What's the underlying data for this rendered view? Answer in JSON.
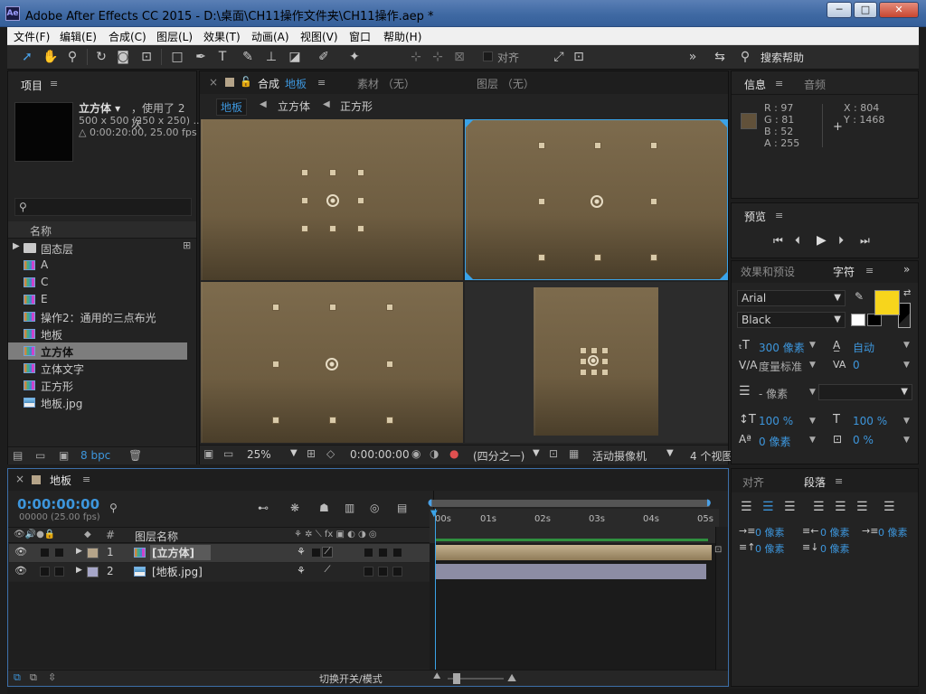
{
  "window": {
    "title": "Adobe After Effects CC 2015 - D:\\桌面\\CH11操作文件夹\\CH11操作.aep *",
    "app_icon": "Ae"
  },
  "menu": [
    "文件(F)",
    "编辑(E)",
    "合成(C)",
    "图层(L)",
    "效果(T)",
    "动画(A)",
    "视图(V)",
    "窗口",
    "帮助(H)"
  ],
  "toolbar": {
    "snap_label": "对齐",
    "search_help": "搜索帮助"
  },
  "project": {
    "tab": "项目",
    "item_name": "立方体 ▾",
    "item_usage": "，使用了 2 次",
    "item_size": "500 x 500  (250 x 250) ...",
    "item_duration": "△ 0:00:20:00, 25.00 fps",
    "col_name": "名称",
    "items": [
      {
        "name": "固态层",
        "type": "folder"
      },
      {
        "name": "A",
        "type": "comp"
      },
      {
        "name": "C",
        "type": "comp"
      },
      {
        "name": "E",
        "type": "comp"
      },
      {
        "name": "操作2：通用的三点布光",
        "type": "comp"
      },
      {
        "name": "地板",
        "type": "comp"
      },
      {
        "name": "立方体",
        "type": "comp",
        "selected": true
      },
      {
        "name": "立体文字",
        "type": "comp"
      },
      {
        "name": "正方形",
        "type": "comp"
      },
      {
        "name": "地板.jpg",
        "type": "image"
      }
    ],
    "bpc": "8 bpc"
  },
  "comp": {
    "tab_prefix": "合成",
    "tab_name": "地板",
    "footage_tab": "素材 （无）",
    "layer_tab": "图层 （无）",
    "breadcrumbs": [
      "地板",
      "立方体",
      "正方形"
    ],
    "zoom": "25%",
    "timecode": "0:00:00:00",
    "resolution": "(四分之一)",
    "camera": "活动摄像机",
    "views": "4 个视图"
  },
  "info": {
    "tab": "信息",
    "audio_tab": "音频",
    "r": "R : 97",
    "g": "G : 81",
    "b": "B : 52",
    "a": "A : 255",
    "x": "X : 804",
    "y": "Y : 1468",
    "swatch_color": "#61513a"
  },
  "preview": {
    "tab": "预览"
  },
  "character": {
    "effects_tab": "效果和预设",
    "tab": "字符",
    "font": "Arial",
    "style": "Black",
    "size": "300 像素",
    "leading": "自动",
    "kerning": "度量标准",
    "tracking": "0",
    "stroke": "- 像素",
    "vscale": "100 %",
    "hscale": "100 %",
    "baseline": "0 像素",
    "tsume": "0 %",
    "fill_color": "#f7d51c"
  },
  "paragraph": {
    "align_tab": "对齐",
    "tab": "段落",
    "indent_left": "0 像素",
    "indent_first": "0 像素",
    "indent_right": "0 像素",
    "space_before": "0 像素",
    "space_after": "0 像素"
  },
  "timeline": {
    "tab": "地板",
    "timecode": "0:00:00:00",
    "fps": "00000 (25.00 fps)",
    "col_num": "#",
    "col_name": "图层名称",
    "layers": [
      {
        "num": "1",
        "name": "[立方体]",
        "color": "#b5a489"
      },
      {
        "num": "2",
        "name": "[地板.jpg]",
        "color": "#a6a6c8"
      }
    ],
    "ticks": [
      "00s",
      "01s",
      "02s",
      "03s",
      "04s",
      "05s"
    ],
    "toggle_label": "切换开关/模式"
  }
}
